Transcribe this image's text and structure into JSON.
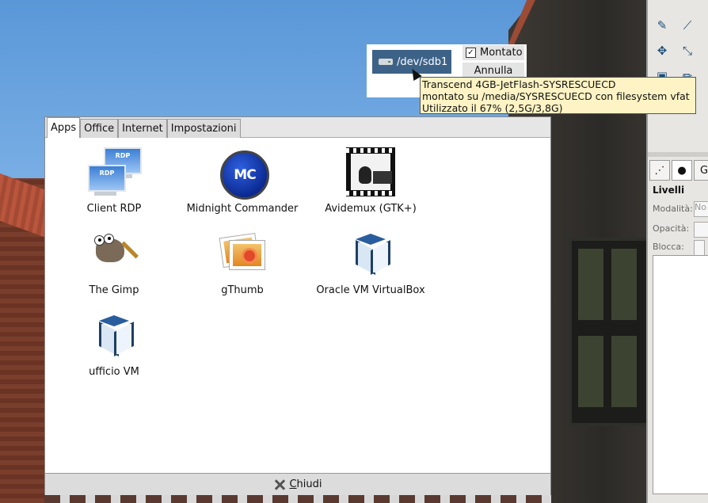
{
  "mount_popup": {
    "device_label": "/dev/sdb1",
    "mounted_label": "Montato",
    "mounted_checked": true,
    "mounted_check_glyph": "✓",
    "cancel_label": "Annulla"
  },
  "tooltip": {
    "line1": "Transcend 4GB-JetFlash-SYSRESCUECD",
    "line2": "montato su /media/SYSRESCUECD con filesystem vfat",
    "line3": "Utilizzato il 67% (2,5G/3,8G)"
  },
  "launcher": {
    "tabs": [
      {
        "label": "Apps",
        "active": true
      },
      {
        "label": "Office",
        "active": false
      },
      {
        "label": "Internet",
        "active": false
      },
      {
        "label": "Impostazioni",
        "active": false
      }
    ],
    "apps": [
      {
        "label": "Client RDP",
        "icon": "rdp-icon",
        "rdp_text": "RDP"
      },
      {
        "label": "Midnight Commander",
        "icon": "midnight-commander-icon",
        "mc_text": "MC"
      },
      {
        "label": "Avidemux (GTK+)",
        "icon": "avidemux-icon"
      },
      {
        "label": "The Gimp",
        "icon": "gimp-icon"
      },
      {
        "label": "gThumb",
        "icon": "gthumb-icon"
      },
      {
        "label": "Oracle VM VirtualBox",
        "icon": "virtualbox-icon"
      },
      {
        "label": "ufficio VM",
        "icon": "virtualbox-icon"
      }
    ],
    "close_prefix": "C",
    "close_rest": "hiudi"
  },
  "gimp_panel": {
    "title": "Livelli",
    "mode_label": "Modalità:",
    "mode_value": "No",
    "opacity_label": "Opacità:",
    "lock_label": "Blocca:"
  }
}
